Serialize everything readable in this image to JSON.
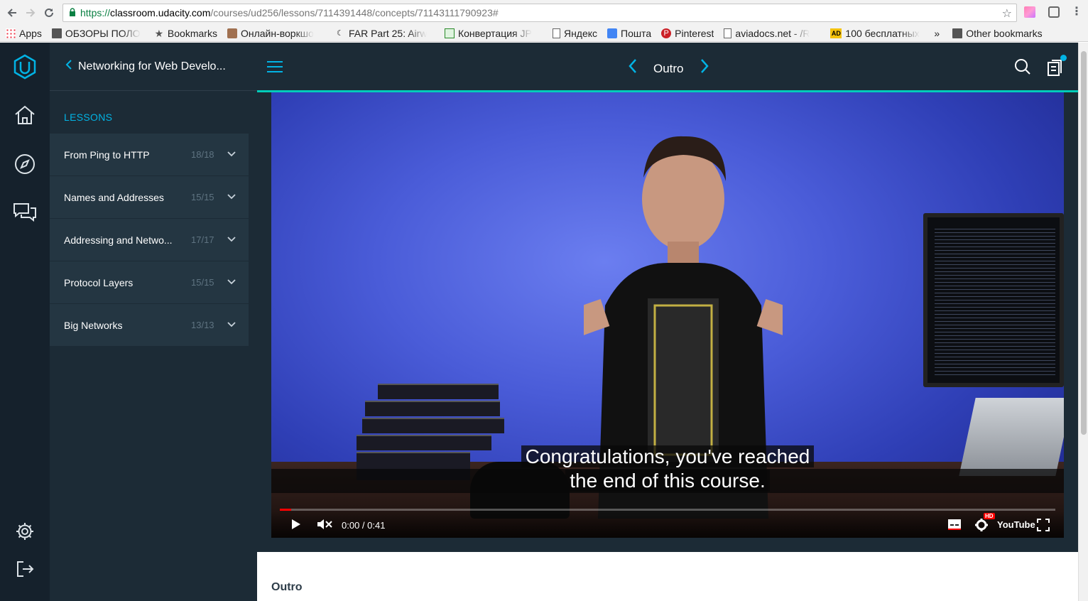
{
  "browser": {
    "url_scheme": "https://",
    "url_host": "classroom.udacity.com",
    "url_path": "/courses/ud256/lessons/7114391448/concepts/71143111790923#",
    "bookmarks": [
      {
        "label": "Apps",
        "icon": "apps-grid-icon"
      },
      {
        "label": "ОБЗОРЫ ПОЛО",
        "icon": "folder-icon"
      },
      {
        "label": "Bookmarks",
        "icon": "star-icon"
      },
      {
        "label": "Онлайн-воркшо",
        "icon": "user-icon"
      },
      {
        "label": "FAR Part 25: Airw",
        "icon": "far-icon"
      },
      {
        "label": "Конвертация JP",
        "icon": "convert-icon"
      },
      {
        "label": "Яндекс",
        "icon": "doc-icon"
      },
      {
        "label": "Пошта",
        "icon": "mail-icon"
      },
      {
        "label": "Pinterest",
        "icon": "pinterest-icon"
      },
      {
        "label": "aviadocs.net - /R",
        "icon": "doc-icon"
      },
      {
        "label": "100 бесплатных",
        "icon": "ad-icon"
      }
    ],
    "overflow": "»",
    "other_bookmarks": "Other bookmarks"
  },
  "course": {
    "title": "Networking for Web Develo...",
    "lessons_heading": "LESSONS",
    "lessons": [
      {
        "name": "From Ping to HTTP",
        "count": "18/18"
      },
      {
        "name": "Names and Addresses",
        "count": "15/15"
      },
      {
        "name": "Addressing and Netwo...",
        "count": "17/17"
      },
      {
        "name": "Protocol Layers",
        "count": "15/15"
      },
      {
        "name": "Big Networks",
        "count": "13/13"
      }
    ]
  },
  "header": {
    "concept_title": "Outro"
  },
  "video": {
    "caption_line1": "Congratulations, you've reached",
    "caption_line2": "the end of this course.",
    "time": "0:00 / 0:41",
    "progress_fraction": 0.015,
    "brand": "YouTube",
    "hd_badge": "HD"
  },
  "content": {
    "concept_heading": "Outro"
  },
  "colors": {
    "accent": "#02b3e4",
    "teal_rule": "#02ccba",
    "sidebar_dark": "#15212c",
    "panel": "#1c2b36"
  }
}
